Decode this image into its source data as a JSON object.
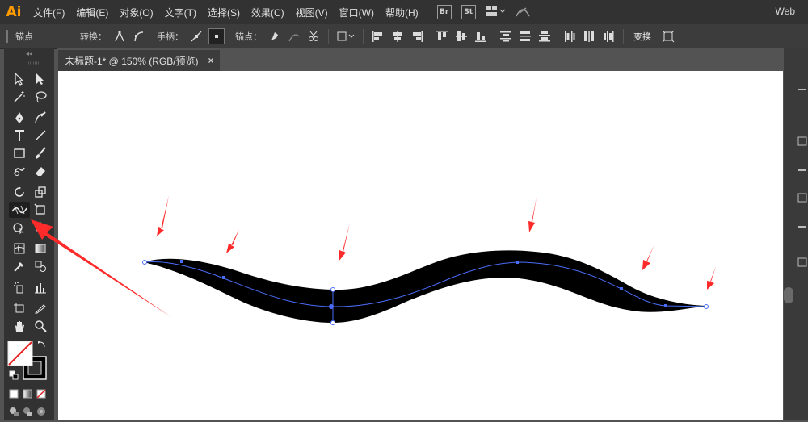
{
  "app": {
    "logo": "Ai",
    "workspace": "Web"
  },
  "menu": {
    "items": [
      "文件(F)",
      "编辑(E)",
      "对象(O)",
      "文字(T)",
      "选择(S)",
      "效果(C)",
      "视图(V)",
      "窗口(W)",
      "帮助(H)"
    ],
    "badges": [
      "Br",
      "St"
    ]
  },
  "control_bar": {
    "anchor_label": "锚点",
    "convert_label": "转换：",
    "handles_label": "手柄：",
    "anchors_label": "锚点：",
    "transform_button": "变换"
  },
  "document": {
    "tab_title": "未标题-1* @ 150% (RGB/预览)",
    "close_glyph": "×"
  },
  "artwork": {
    "stroke_color": "#000000",
    "path_color": "#4a6cf7",
    "annotation_color": "#ff2a2a"
  }
}
